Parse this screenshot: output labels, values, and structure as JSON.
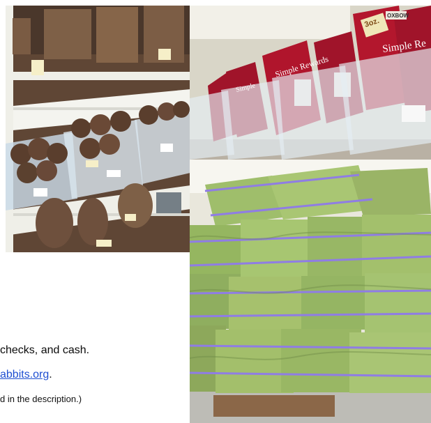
{
  "photos": {
    "shelf": {
      "alt": "Store shelving with baskets and woven balls",
      "colors": {
        "wall": "#5f4635",
        "shelf": "#f4f4ef",
        "basket": "#7e6047",
        "ball": "#5a3e2d",
        "bin": "#d9e5ee",
        "tag": "#f6efc8"
      }
    },
    "treats": {
      "alt": "Clear bins filled with red treat packages",
      "package_text": [
        "3oz.",
        "OXBOW",
        "Simple Re",
        "Simple Rewards",
        "Simple"
      ],
      "colors": {
        "wall": "#d9d6c8",
        "package": "#a0142a",
        "bin": "#e5edf3",
        "shelf": "#b9b1a4"
      }
    },
    "hay": {
      "alt": "Stacked hay bales on a pallet",
      "colors": {
        "hay": "#9fbe6b",
        "hay_dark": "#6e8c47",
        "band": "#8f7de4",
        "pallet": "#8b6748",
        "floor": "#bdbcb6"
      }
    }
  },
  "footer": {
    "payment_text": "checks, and cash.",
    "website_text": "abbits.org",
    "website_suffix": ".",
    "description_text": "d in the description.)"
  }
}
